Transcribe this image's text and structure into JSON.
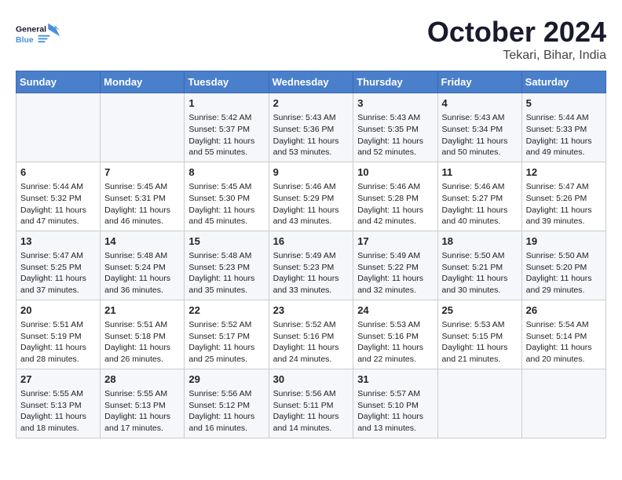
{
  "header": {
    "logo_general": "General",
    "logo_blue": "Blue",
    "month": "October 2024",
    "location": "Tekari, Bihar, India"
  },
  "weekdays": [
    "Sunday",
    "Monday",
    "Tuesday",
    "Wednesday",
    "Thursday",
    "Friday",
    "Saturday"
  ],
  "weeks": [
    [
      {
        "day": "",
        "sunrise": "",
        "sunset": "",
        "daylight": ""
      },
      {
        "day": "",
        "sunrise": "",
        "sunset": "",
        "daylight": ""
      },
      {
        "day": "1",
        "sunrise": "Sunrise: 5:42 AM",
        "sunset": "Sunset: 5:37 PM",
        "daylight": "Daylight: 11 hours and 55 minutes."
      },
      {
        "day": "2",
        "sunrise": "Sunrise: 5:43 AM",
        "sunset": "Sunset: 5:36 PM",
        "daylight": "Daylight: 11 hours and 53 minutes."
      },
      {
        "day": "3",
        "sunrise": "Sunrise: 5:43 AM",
        "sunset": "Sunset: 5:35 PM",
        "daylight": "Daylight: 11 hours and 52 minutes."
      },
      {
        "day": "4",
        "sunrise": "Sunrise: 5:43 AM",
        "sunset": "Sunset: 5:34 PM",
        "daylight": "Daylight: 11 hours and 50 minutes."
      },
      {
        "day": "5",
        "sunrise": "Sunrise: 5:44 AM",
        "sunset": "Sunset: 5:33 PM",
        "daylight": "Daylight: 11 hours and 49 minutes."
      }
    ],
    [
      {
        "day": "6",
        "sunrise": "Sunrise: 5:44 AM",
        "sunset": "Sunset: 5:32 PM",
        "daylight": "Daylight: 11 hours and 47 minutes."
      },
      {
        "day": "7",
        "sunrise": "Sunrise: 5:45 AM",
        "sunset": "Sunset: 5:31 PM",
        "daylight": "Daylight: 11 hours and 46 minutes."
      },
      {
        "day": "8",
        "sunrise": "Sunrise: 5:45 AM",
        "sunset": "Sunset: 5:30 PM",
        "daylight": "Daylight: 11 hours and 45 minutes."
      },
      {
        "day": "9",
        "sunrise": "Sunrise: 5:46 AM",
        "sunset": "Sunset: 5:29 PM",
        "daylight": "Daylight: 11 hours and 43 minutes."
      },
      {
        "day": "10",
        "sunrise": "Sunrise: 5:46 AM",
        "sunset": "Sunset: 5:28 PM",
        "daylight": "Daylight: 11 hours and 42 minutes."
      },
      {
        "day": "11",
        "sunrise": "Sunrise: 5:46 AM",
        "sunset": "Sunset: 5:27 PM",
        "daylight": "Daylight: 11 hours and 40 minutes."
      },
      {
        "day": "12",
        "sunrise": "Sunrise: 5:47 AM",
        "sunset": "Sunset: 5:26 PM",
        "daylight": "Daylight: 11 hours and 39 minutes."
      }
    ],
    [
      {
        "day": "13",
        "sunrise": "Sunrise: 5:47 AM",
        "sunset": "Sunset: 5:25 PM",
        "daylight": "Daylight: 11 hours and 37 minutes."
      },
      {
        "day": "14",
        "sunrise": "Sunrise: 5:48 AM",
        "sunset": "Sunset: 5:24 PM",
        "daylight": "Daylight: 11 hours and 36 minutes."
      },
      {
        "day": "15",
        "sunrise": "Sunrise: 5:48 AM",
        "sunset": "Sunset: 5:23 PM",
        "daylight": "Daylight: 11 hours and 35 minutes."
      },
      {
        "day": "16",
        "sunrise": "Sunrise: 5:49 AM",
        "sunset": "Sunset: 5:23 PM",
        "daylight": "Daylight: 11 hours and 33 minutes."
      },
      {
        "day": "17",
        "sunrise": "Sunrise: 5:49 AM",
        "sunset": "Sunset: 5:22 PM",
        "daylight": "Daylight: 11 hours and 32 minutes."
      },
      {
        "day": "18",
        "sunrise": "Sunrise: 5:50 AM",
        "sunset": "Sunset: 5:21 PM",
        "daylight": "Daylight: 11 hours and 30 minutes."
      },
      {
        "day": "19",
        "sunrise": "Sunrise: 5:50 AM",
        "sunset": "Sunset: 5:20 PM",
        "daylight": "Daylight: 11 hours and 29 minutes."
      }
    ],
    [
      {
        "day": "20",
        "sunrise": "Sunrise: 5:51 AM",
        "sunset": "Sunset: 5:19 PM",
        "daylight": "Daylight: 11 hours and 28 minutes."
      },
      {
        "day": "21",
        "sunrise": "Sunrise: 5:51 AM",
        "sunset": "Sunset: 5:18 PM",
        "daylight": "Daylight: 11 hours and 26 minutes."
      },
      {
        "day": "22",
        "sunrise": "Sunrise: 5:52 AM",
        "sunset": "Sunset: 5:17 PM",
        "daylight": "Daylight: 11 hours and 25 minutes."
      },
      {
        "day": "23",
        "sunrise": "Sunrise: 5:52 AM",
        "sunset": "Sunset: 5:16 PM",
        "daylight": "Daylight: 11 hours and 24 minutes."
      },
      {
        "day": "24",
        "sunrise": "Sunrise: 5:53 AM",
        "sunset": "Sunset: 5:16 PM",
        "daylight": "Daylight: 11 hours and 22 minutes."
      },
      {
        "day": "25",
        "sunrise": "Sunrise: 5:53 AM",
        "sunset": "Sunset: 5:15 PM",
        "daylight": "Daylight: 11 hours and 21 minutes."
      },
      {
        "day": "26",
        "sunrise": "Sunrise: 5:54 AM",
        "sunset": "Sunset: 5:14 PM",
        "daylight": "Daylight: 11 hours and 20 minutes."
      }
    ],
    [
      {
        "day": "27",
        "sunrise": "Sunrise: 5:55 AM",
        "sunset": "Sunset: 5:13 PM",
        "daylight": "Daylight: 11 hours and 18 minutes."
      },
      {
        "day": "28",
        "sunrise": "Sunrise: 5:55 AM",
        "sunset": "Sunset: 5:13 PM",
        "daylight": "Daylight: 11 hours and 17 minutes."
      },
      {
        "day": "29",
        "sunrise": "Sunrise: 5:56 AM",
        "sunset": "Sunset: 5:12 PM",
        "daylight": "Daylight: 11 hours and 16 minutes."
      },
      {
        "day": "30",
        "sunrise": "Sunrise: 5:56 AM",
        "sunset": "Sunset: 5:11 PM",
        "daylight": "Daylight: 11 hours and 14 minutes."
      },
      {
        "day": "31",
        "sunrise": "Sunrise: 5:57 AM",
        "sunset": "Sunset: 5:10 PM",
        "daylight": "Daylight: 11 hours and 13 minutes."
      },
      {
        "day": "",
        "sunrise": "",
        "sunset": "",
        "daylight": ""
      },
      {
        "day": "",
        "sunrise": "",
        "sunset": "",
        "daylight": ""
      }
    ]
  ]
}
